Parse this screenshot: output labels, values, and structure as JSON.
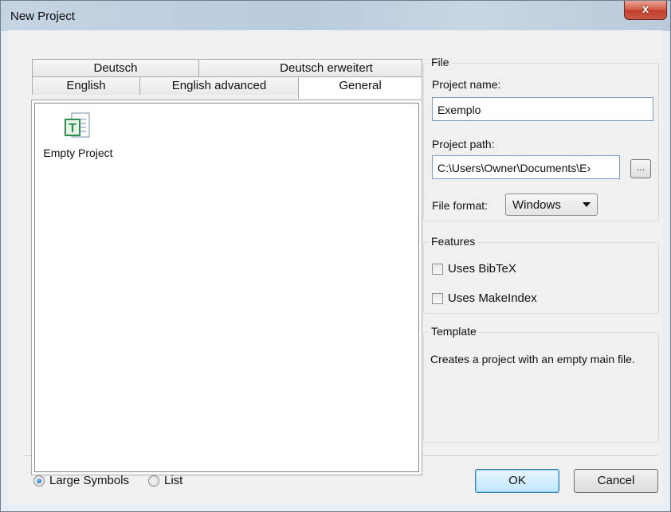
{
  "window": {
    "title": "New Project",
    "close_label": "x"
  },
  "tabs": {
    "row_back": [
      {
        "label": "Deutsch"
      },
      {
        "label": "Deutsch erweitert"
      }
    ],
    "row_front": [
      {
        "label": "English"
      },
      {
        "label": "English advanced"
      },
      {
        "label": "General",
        "selected": true
      }
    ]
  },
  "templates": [
    {
      "label": "Empty Project",
      "icon": "tex-document-icon"
    }
  ],
  "file_group": {
    "title": "File",
    "project_name_label": "Project name:",
    "project_name_value": "Exemplo",
    "project_path_label": "Project path:",
    "project_path_value": "C:\\Users\\Owner\\Documents\\E›",
    "browse_label": "...",
    "file_format_label": "File format:",
    "file_format_value": "Windows"
  },
  "features_group": {
    "title": "Features",
    "options": [
      {
        "label": "Uses BibTeX",
        "checked": false
      },
      {
        "label": "Uses MakeIndex",
        "checked": false
      }
    ]
  },
  "template_group": {
    "title": "Template",
    "description": "Creates a project with an empty main file."
  },
  "view_mode": {
    "options": [
      {
        "label": "Large Symbols",
        "selected": true
      },
      {
        "label": "List",
        "selected": false
      }
    ]
  },
  "buttons": {
    "ok": "OK",
    "cancel": "Cancel"
  },
  "colors": {
    "accent": "#3c7fb1",
    "icon_green": "#2f8f4e",
    "close_red": "#c1402b"
  }
}
